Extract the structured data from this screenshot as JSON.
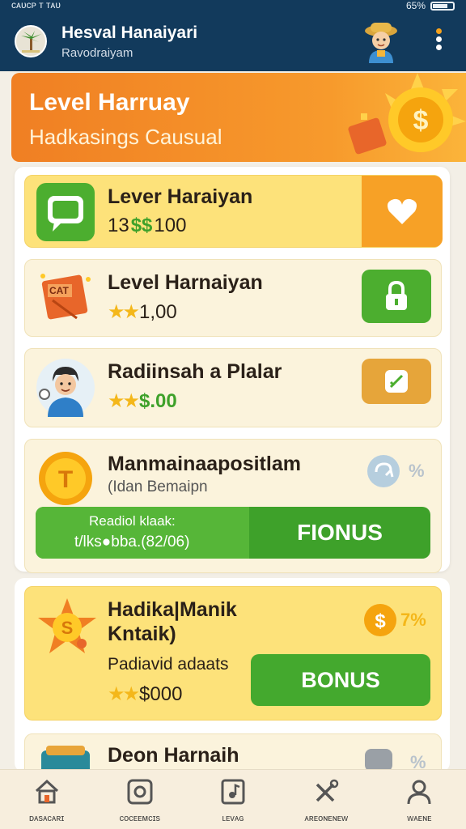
{
  "status": {
    "left_text": "ᴄᴀᴜᴄᴘ ᴛ ᴛᴀᴜ",
    "battery": "65%"
  },
  "header": {
    "title": "Hesval Hanaiyari",
    "subtitle": "Ravodraiyam"
  },
  "banner": {
    "title": "Level Harruay",
    "subtitle": "Hadkasings Causual"
  },
  "rows": [
    {
      "name": "Lever Haraiyan",
      "value_prefix": "13",
      "value_accent": "$$",
      "value_suffix": "100"
    },
    {
      "name": "Level Harnaiyan",
      "stars": "★★",
      "value": "1,00"
    },
    {
      "name": "Radiinsah a Plalar",
      "stars": "★★",
      "value": "$.00"
    },
    {
      "name": "Manmainaapositlam",
      "sub": "(Idan Bemaipn",
      "percent": "%"
    },
    {
      "name_line1": "Hadika|Manik",
      "name_line2": "Kntaik)",
      "sub": "Padiavid adaats",
      "stars": "★★",
      "value": "$000",
      "percent": "7%"
    },
    {
      "name": "Deon Harnaih",
      "percent": "%"
    }
  ],
  "bonus_bar": {
    "line1": "Readiol klaak:",
    "line2": "t/lks●bba.(82/06)",
    "button": "FIONUS"
  },
  "bonus_button": "BONUS",
  "nav": [
    {
      "label": "ᴅᴀsᴀᴄᴀʀɪ",
      "icon": "home-icon"
    },
    {
      "label": "ᴄᴏᴄᴇᴇᴍᴄɪs",
      "icon": "target-icon"
    },
    {
      "label": "ʟᴇᴠᴀɢ",
      "icon": "music-icon"
    },
    {
      "label": "ᴀʀᴇᴏɴᴇɴᴇᴡ",
      "icon": "tools-icon"
    },
    {
      "label": "ᴡᴀᴇɴᴇ",
      "icon": "profile-icon"
    }
  ],
  "colors": {
    "header": "#123a5c",
    "banner": "#f07f23",
    "green": "#3ea12a",
    "gold": "#f4b71a"
  }
}
